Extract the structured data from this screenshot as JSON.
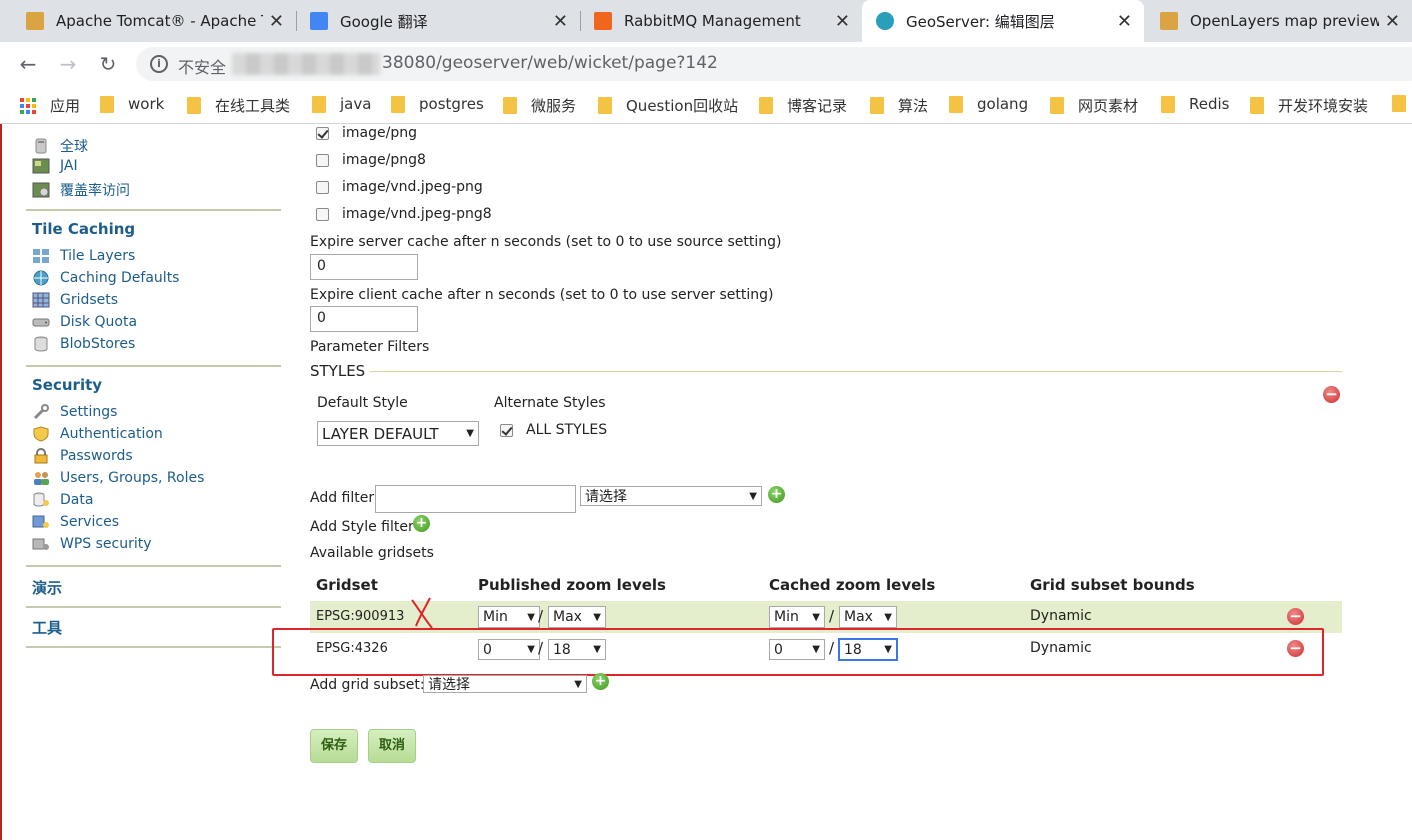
{
  "browser": {
    "tabs": [
      {
        "title": "Apache Tomcat® - Apache Tomcat",
        "favicon_color": "#d9a441"
      },
      {
        "title": "Google 翻译",
        "favicon_color": "#4285f4"
      },
      {
        "title": "RabbitMQ Management",
        "favicon_color": "#f0661e"
      },
      {
        "title": "GeoServer: 编辑图层",
        "favicon_color": "#2a9fb9"
      },
      {
        "title": "OpenLayers map preview",
        "favicon_color": "#d9a441"
      }
    ],
    "active_tab_index": 3,
    "close_glyph": "✕",
    "nav": {
      "back": "←",
      "forward": "→",
      "reload": "↻"
    },
    "omnibox": {
      "security_label": "不安全",
      "url_visible": "38080/geoserver/web/wicket/page?142"
    },
    "bookmarks": [
      {
        "label": "应用",
        "icon": "apps-grid-icon"
      },
      {
        "label": "work"
      },
      {
        "label": "在线工具类"
      },
      {
        "label": "java"
      },
      {
        "label": "postgres"
      },
      {
        "label": "微服务"
      },
      {
        "label": "Question回收站"
      },
      {
        "label": "博客记录"
      },
      {
        "label": "算法"
      },
      {
        "label": "golang"
      },
      {
        "label": "网页素材"
      },
      {
        "label": "Redis"
      },
      {
        "label": "开发环境安装"
      }
    ]
  },
  "sidebar": {
    "top_items": [
      {
        "label": "全球",
        "icon": "globe-settings-icon"
      },
      {
        "label": "JAI",
        "icon": "jai-icon"
      },
      {
        "label": "覆盖率访问",
        "icon": "coverage-access-icon"
      }
    ],
    "sections": [
      {
        "title": "Tile Caching",
        "items": [
          {
            "label": "Tile Layers",
            "icon": "tile-layers-icon"
          },
          {
            "label": "Caching Defaults",
            "icon": "caching-defaults-icon"
          },
          {
            "label": "Gridsets",
            "icon": "gridsets-icon"
          },
          {
            "label": "Disk Quota",
            "icon": "disk-quota-icon"
          },
          {
            "label": "BlobStores",
            "icon": "blobstores-icon"
          }
        ]
      },
      {
        "title": "Security",
        "items": [
          {
            "label": "Settings",
            "icon": "settings-wrench-icon"
          },
          {
            "label": "Authentication",
            "icon": "shield-icon"
          },
          {
            "label": "Passwords",
            "icon": "lock-icon"
          },
          {
            "label": "Users, Groups, Roles",
            "icon": "users-icon"
          },
          {
            "label": "Data",
            "icon": "data-key-icon"
          },
          {
            "label": "Services",
            "icon": "services-key-icon"
          },
          {
            "label": "WPS security",
            "icon": "wps-security-icon"
          }
        ]
      },
      {
        "title": "演示",
        "items": []
      },
      {
        "title": "工具",
        "items": []
      }
    ]
  },
  "form": {
    "formats": [
      {
        "label": "image/png",
        "checked": true
      },
      {
        "label": "image/png8",
        "checked": false
      },
      {
        "label": "image/vnd.jpeg-png",
        "checked": false
      },
      {
        "label": "image/vnd.jpeg-png8",
        "checked": false
      }
    ],
    "expire_server": {
      "label": "Expire server cache after n seconds (set to 0 to use source setting)",
      "value": "0"
    },
    "expire_client": {
      "label": "Expire client cache after n seconds (set to 0 to use server setting)",
      "value": "0"
    },
    "parameter_filters_label": "Parameter Filters",
    "styles": {
      "heading": "STYLES",
      "default_style_label": "Default Style",
      "default_style_value": "LAYER DEFAULT",
      "alternate_styles_label": "Alternate Styles",
      "all_styles_label": "ALL STYLES",
      "all_styles_checked": true
    },
    "add_filter": {
      "label": "Add filter",
      "value": "",
      "select_value": "请选择"
    },
    "add_style_filter_label": "Add Style filter",
    "available_gridsets_label": "Available gridsets",
    "gridset_table": {
      "headers": [
        "Gridset",
        "Published zoom levels",
        "Cached zoom levels",
        "Grid subset bounds"
      ],
      "rows": [
        {
          "gridset": "EPSG:900913",
          "pub_min": "Min",
          "pub_max": "Max",
          "cache_min": "Min",
          "cache_max": "Max",
          "bounds": "Dynamic"
        },
        {
          "gridset": "EPSG:4326",
          "pub_min": "0",
          "pub_max": "18",
          "cache_min": "0",
          "cache_max": "18",
          "bounds": "Dynamic"
        }
      ],
      "separator": "/"
    },
    "add_grid_subset": {
      "label": "Add grid subset:",
      "select_value": "请选择"
    },
    "save_label": "保存",
    "cancel_label": "取消"
  },
  "colors": {
    "link": "#1d5d8b",
    "row_highlight": "#e4eecd",
    "annotation_red": "#e0242b",
    "button_green": "#b6dc95"
  }
}
